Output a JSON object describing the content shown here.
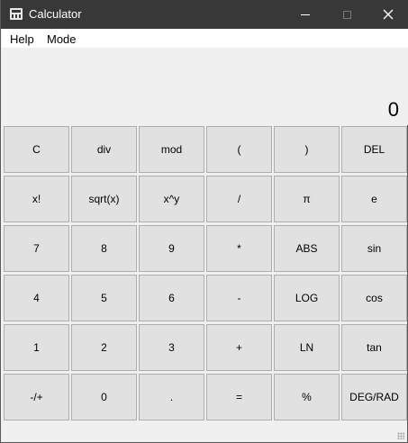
{
  "window": {
    "title": "Calculator"
  },
  "menubar": {
    "items": [
      "Help",
      "Mode"
    ]
  },
  "display": {
    "value": "0"
  },
  "keypad": {
    "rows": [
      [
        "C",
        "div",
        "mod",
        "(",
        ")",
        "DEL"
      ],
      [
        "x!",
        "sqrt(x)",
        "x^y",
        "/",
        "π",
        "e"
      ],
      [
        "7",
        "8",
        "9",
        "*",
        "ABS",
        "sin"
      ],
      [
        "4",
        "5",
        "6",
        "-",
        "LOG",
        "cos"
      ],
      [
        "1",
        "2",
        "3",
        "+",
        "LN",
        "tan"
      ],
      [
        "-/+",
        "0",
        ".",
        "=",
        "%",
        "DEG/RAD"
      ]
    ]
  },
  "colors": {
    "titlebar": "#383838",
    "window_bg": "#f0f0f0",
    "key_bg": "#e1e1e1",
    "key_border": "#adadad"
  }
}
